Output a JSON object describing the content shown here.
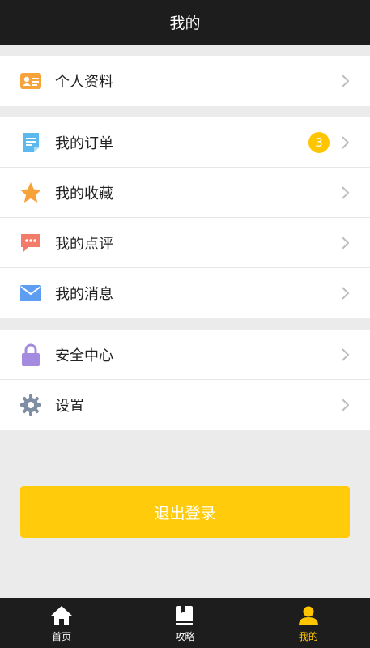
{
  "header": {
    "title": "我的"
  },
  "groups": [
    {
      "items": [
        {
          "label": "个人资料",
          "icon": "profile-card-icon"
        }
      ]
    },
    {
      "items": [
        {
          "label": "我的订单",
          "icon": "order-icon",
          "badge": "3"
        },
        {
          "label": "我的收藏",
          "icon": "star-icon"
        },
        {
          "label": "我的点评",
          "icon": "comment-icon"
        },
        {
          "label": "我的消息",
          "icon": "mail-icon"
        }
      ]
    },
    {
      "items": [
        {
          "label": "安全中心",
          "icon": "lock-icon"
        },
        {
          "label": "设置",
          "icon": "gear-icon"
        }
      ]
    }
  ],
  "logout": {
    "label": "退出登录"
  },
  "tabbar": {
    "tabs": [
      {
        "label": "首页",
        "icon": "home-icon",
        "active": false
      },
      {
        "label": "攻略",
        "icon": "guide-book-icon",
        "active": false
      },
      {
        "label": "我的",
        "icon": "user-icon",
        "active": true
      }
    ]
  },
  "colors": {
    "accent": "#ffc600",
    "header_bg": "#1d1d1d",
    "page_bg": "#ebebeb"
  }
}
